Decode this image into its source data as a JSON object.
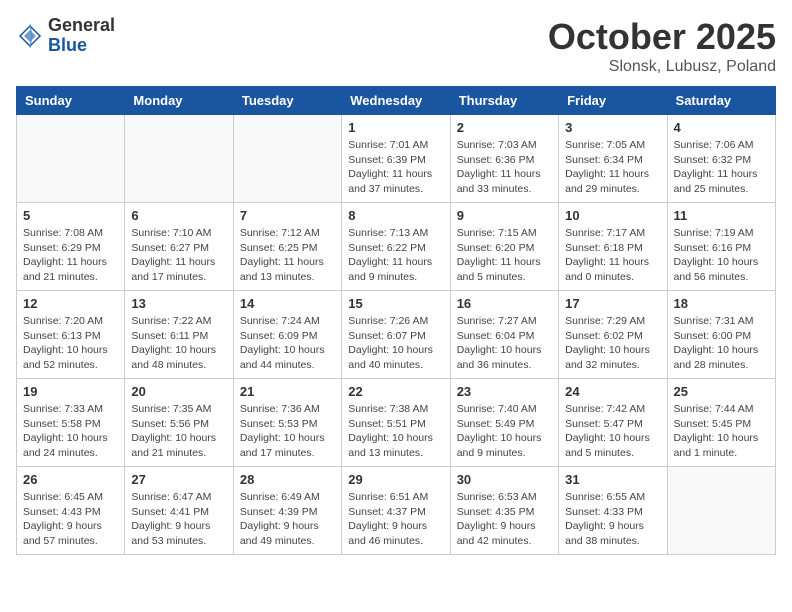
{
  "logo": {
    "general": "General",
    "blue": "Blue"
  },
  "title": {
    "month_year": "October 2025",
    "location": "Slonsk, Lubusz, Poland"
  },
  "weekdays": [
    "Sunday",
    "Monday",
    "Tuesday",
    "Wednesday",
    "Thursday",
    "Friday",
    "Saturday"
  ],
  "weeks": [
    [
      {
        "day": "",
        "info": ""
      },
      {
        "day": "",
        "info": ""
      },
      {
        "day": "",
        "info": ""
      },
      {
        "day": "1",
        "info": "Sunrise: 7:01 AM\nSunset: 6:39 PM\nDaylight: 11 hours\nand 37 minutes."
      },
      {
        "day": "2",
        "info": "Sunrise: 7:03 AM\nSunset: 6:36 PM\nDaylight: 11 hours\nand 33 minutes."
      },
      {
        "day": "3",
        "info": "Sunrise: 7:05 AM\nSunset: 6:34 PM\nDaylight: 11 hours\nand 29 minutes."
      },
      {
        "day": "4",
        "info": "Sunrise: 7:06 AM\nSunset: 6:32 PM\nDaylight: 11 hours\nand 25 minutes."
      }
    ],
    [
      {
        "day": "5",
        "info": "Sunrise: 7:08 AM\nSunset: 6:29 PM\nDaylight: 11 hours\nand 21 minutes."
      },
      {
        "day": "6",
        "info": "Sunrise: 7:10 AM\nSunset: 6:27 PM\nDaylight: 11 hours\nand 17 minutes."
      },
      {
        "day": "7",
        "info": "Sunrise: 7:12 AM\nSunset: 6:25 PM\nDaylight: 11 hours\nand 13 minutes."
      },
      {
        "day": "8",
        "info": "Sunrise: 7:13 AM\nSunset: 6:22 PM\nDaylight: 11 hours\nand 9 minutes."
      },
      {
        "day": "9",
        "info": "Sunrise: 7:15 AM\nSunset: 6:20 PM\nDaylight: 11 hours\nand 5 minutes."
      },
      {
        "day": "10",
        "info": "Sunrise: 7:17 AM\nSunset: 6:18 PM\nDaylight: 11 hours\nand 0 minutes."
      },
      {
        "day": "11",
        "info": "Sunrise: 7:19 AM\nSunset: 6:16 PM\nDaylight: 10 hours\nand 56 minutes."
      }
    ],
    [
      {
        "day": "12",
        "info": "Sunrise: 7:20 AM\nSunset: 6:13 PM\nDaylight: 10 hours\nand 52 minutes."
      },
      {
        "day": "13",
        "info": "Sunrise: 7:22 AM\nSunset: 6:11 PM\nDaylight: 10 hours\nand 48 minutes."
      },
      {
        "day": "14",
        "info": "Sunrise: 7:24 AM\nSunset: 6:09 PM\nDaylight: 10 hours\nand 44 minutes."
      },
      {
        "day": "15",
        "info": "Sunrise: 7:26 AM\nSunset: 6:07 PM\nDaylight: 10 hours\nand 40 minutes."
      },
      {
        "day": "16",
        "info": "Sunrise: 7:27 AM\nSunset: 6:04 PM\nDaylight: 10 hours\nand 36 minutes."
      },
      {
        "day": "17",
        "info": "Sunrise: 7:29 AM\nSunset: 6:02 PM\nDaylight: 10 hours\nand 32 minutes."
      },
      {
        "day": "18",
        "info": "Sunrise: 7:31 AM\nSunset: 6:00 PM\nDaylight: 10 hours\nand 28 minutes."
      }
    ],
    [
      {
        "day": "19",
        "info": "Sunrise: 7:33 AM\nSunset: 5:58 PM\nDaylight: 10 hours\nand 24 minutes."
      },
      {
        "day": "20",
        "info": "Sunrise: 7:35 AM\nSunset: 5:56 PM\nDaylight: 10 hours\nand 21 minutes."
      },
      {
        "day": "21",
        "info": "Sunrise: 7:36 AM\nSunset: 5:53 PM\nDaylight: 10 hours\nand 17 minutes."
      },
      {
        "day": "22",
        "info": "Sunrise: 7:38 AM\nSunset: 5:51 PM\nDaylight: 10 hours\nand 13 minutes."
      },
      {
        "day": "23",
        "info": "Sunrise: 7:40 AM\nSunset: 5:49 PM\nDaylight: 10 hours\nand 9 minutes."
      },
      {
        "day": "24",
        "info": "Sunrise: 7:42 AM\nSunset: 5:47 PM\nDaylight: 10 hours\nand 5 minutes."
      },
      {
        "day": "25",
        "info": "Sunrise: 7:44 AM\nSunset: 5:45 PM\nDaylight: 10 hours\nand 1 minute."
      }
    ],
    [
      {
        "day": "26",
        "info": "Sunrise: 6:45 AM\nSunset: 4:43 PM\nDaylight: 9 hours\nand 57 minutes."
      },
      {
        "day": "27",
        "info": "Sunrise: 6:47 AM\nSunset: 4:41 PM\nDaylight: 9 hours\nand 53 minutes."
      },
      {
        "day": "28",
        "info": "Sunrise: 6:49 AM\nSunset: 4:39 PM\nDaylight: 9 hours\nand 49 minutes."
      },
      {
        "day": "29",
        "info": "Sunrise: 6:51 AM\nSunset: 4:37 PM\nDaylight: 9 hours\nand 46 minutes."
      },
      {
        "day": "30",
        "info": "Sunrise: 6:53 AM\nSunset: 4:35 PM\nDaylight: 9 hours\nand 42 minutes."
      },
      {
        "day": "31",
        "info": "Sunrise: 6:55 AM\nSunset: 4:33 PM\nDaylight: 9 hours\nand 38 minutes."
      },
      {
        "day": "",
        "info": ""
      }
    ]
  ]
}
